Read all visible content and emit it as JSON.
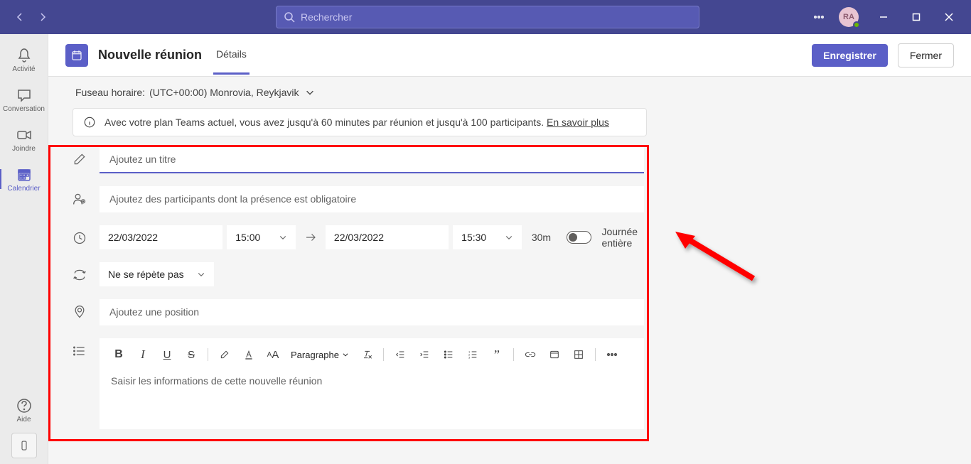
{
  "titlebar": {
    "search_placeholder": "Rechercher",
    "avatar_initials": "RA"
  },
  "rail": {
    "items": [
      {
        "label": "Activité"
      },
      {
        "label": "Conversation"
      },
      {
        "label": "Joindre"
      },
      {
        "label": "Calendrier"
      }
    ],
    "help": "Aide"
  },
  "header": {
    "title": "Nouvelle réunion",
    "tab_details": "Détails",
    "save": "Enregistrer",
    "close": "Fermer"
  },
  "timezone": {
    "label": "Fuseau horaire:",
    "value": "(UTC+00:00) Monrovia, Reykjavik"
  },
  "banner": {
    "text": "Avec votre plan Teams actuel, vous avez jusqu'à 60 minutes par réunion et jusqu'à 100 participants.",
    "learn_more": "En savoir plus"
  },
  "form": {
    "title_placeholder": "Ajoutez un titre",
    "participants_placeholder": "Ajoutez des participants dont la présence est obligatoire",
    "start_date": "22/03/2022",
    "start_time": "15:00",
    "end_date": "22/03/2022",
    "end_time": "15:30",
    "duration": "30m",
    "all_day": "Journée entière",
    "recurrence": "Ne se répète pas",
    "location_placeholder": "Ajoutez une position",
    "paragraph": "Paragraphe",
    "description_placeholder": "Saisir les informations de cette nouvelle réunion"
  }
}
